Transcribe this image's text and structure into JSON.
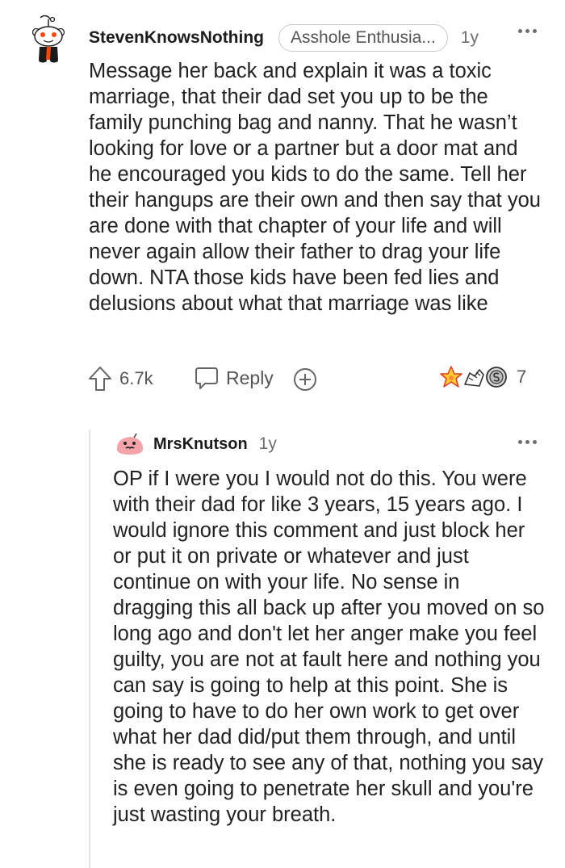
{
  "comments": [
    {
      "username": "StevenKnowsNothing",
      "flair": "Asshole Enthusia...",
      "age": "1y",
      "body": "Message her back and explain it was a toxic marriage, that their dad set you up to be the family punching bag and nanny. That he wasn’t looking for love or a partner but a door mat and he encouraged you kids to do the same. Tell her their hangups are their own and then say that you are done with that chapter of your life and will never again allow their father to drag your life down. NTA those kids have been fed lies and delusions about what that marriage was like",
      "score": "6.7k",
      "reply_label": "Reply",
      "award_count": "7",
      "icons": [
        "upvote-icon",
        "reply-icon",
        "award-icon",
        "more-icon"
      ]
    },
    {
      "username": "MrsKnutson",
      "age": "1y",
      "body": "OP if I were you I would not do this. You were with their dad for like 3 years, 15 years ago. I would ignore this comment and just block her or put it on private or whatever and just continue on with your life. No sense in dragging this all back up after you moved on so long ago and don't let her anger make you feel guilty, you are not at fault here and nothing you can say is going to help at this point. She is going to have to do her own work to get over what her dad did/put them through, and until she is ready to see any of that, nothing you say is even going to penetrate her skull and you're just wasting your breath."
    }
  ],
  "colors": {
    "text": "#222222",
    "meta": "#6e6e6e",
    "thread_line": "#e4e4e4",
    "avatar_pink": "#f4a3a8",
    "snoo_orange": "#ff4500"
  }
}
